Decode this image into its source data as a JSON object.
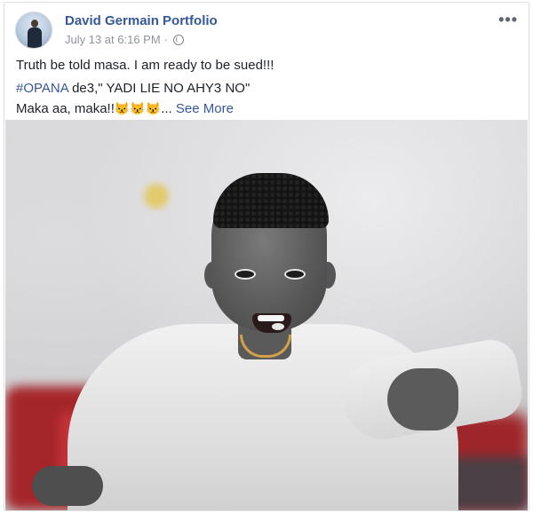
{
  "post": {
    "author_name": "David Germain Portfolio",
    "timestamp": "July 13 at 6:16 PM",
    "separator": "·",
    "privacy_icon": "globe-icon",
    "more_icon": "more-options-icon",
    "more_label": "•••",
    "text_line_1": "Truth be told masa. I am ready to be sued!!!",
    "hashtag": "#OPANA",
    "text_line_2_rest": " de3,\" YADI LIE NO AHY3 NO\"",
    "text_line_3": "Maka aa, maka!!",
    "emojis": "😾😾😾",
    "ellipsis": "...",
    "see_more_label": "See More"
  },
  "colors": {
    "link_blue": "#365899",
    "meta_gray": "#90949c",
    "text": "#1d2129",
    "border": "#dddfe2"
  }
}
